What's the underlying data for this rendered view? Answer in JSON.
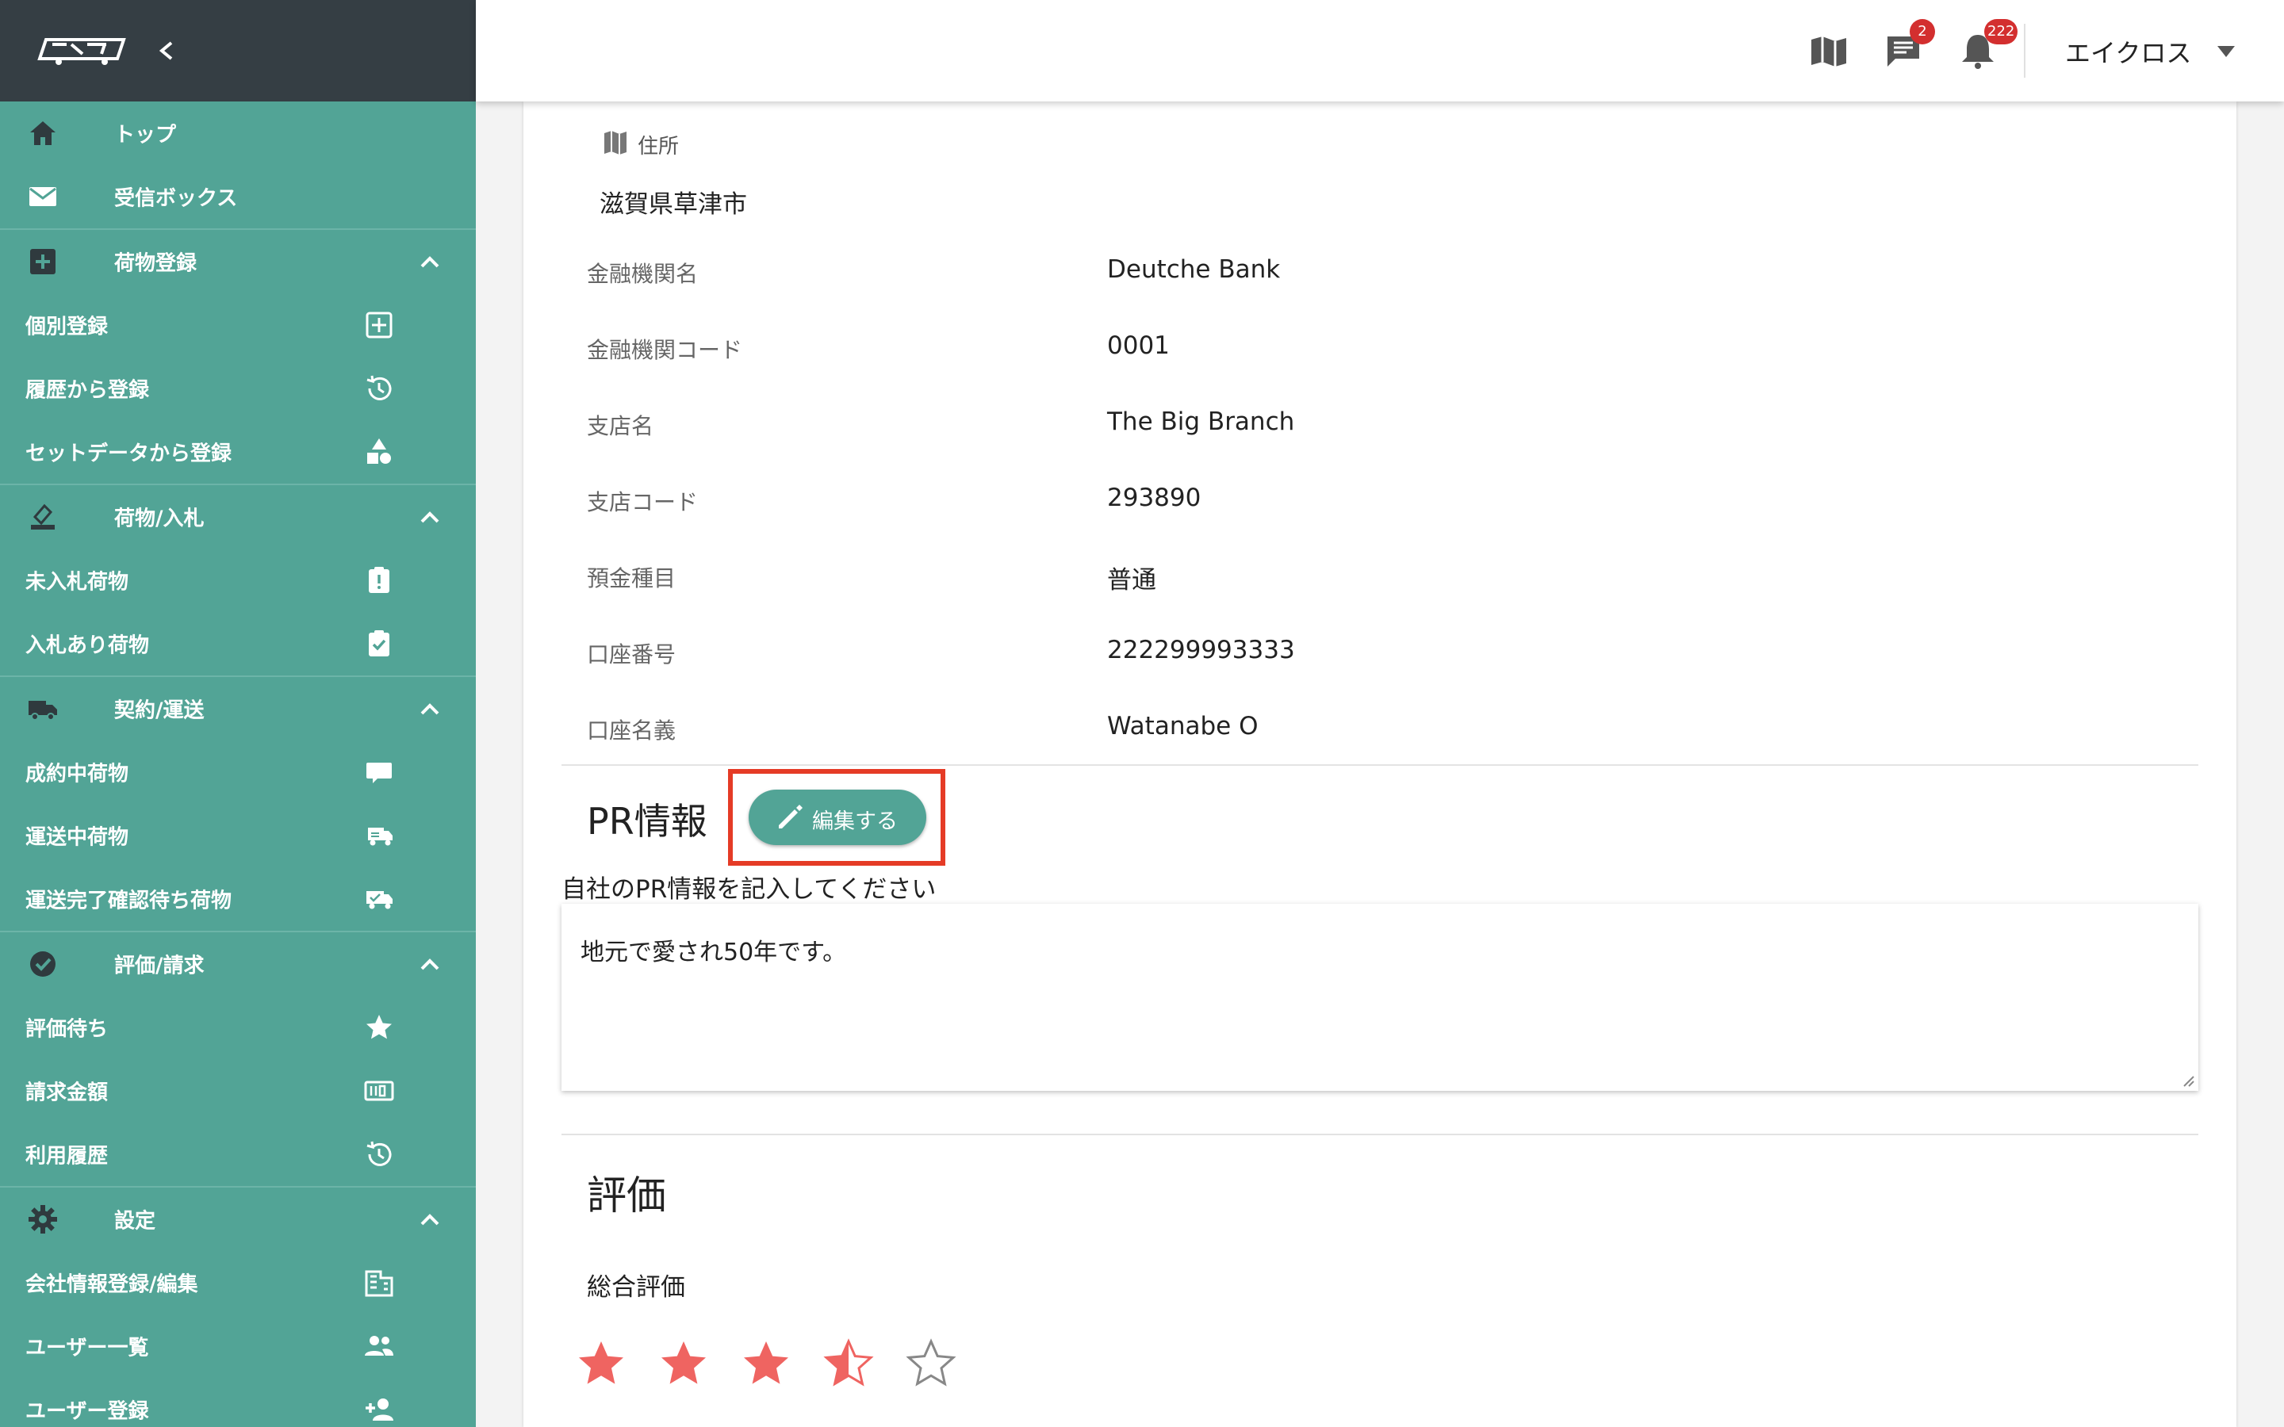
{
  "sidebar": {
    "items": [
      {
        "label": "トップ",
        "type": "top",
        "icon": "home-icon"
      },
      {
        "label": "受信ボックス",
        "type": "top",
        "icon": "mail-icon"
      },
      {
        "label": "荷物登録",
        "type": "section",
        "icon": "add-box-icon"
      },
      {
        "label": "個別登録",
        "type": "sub",
        "icon": "add-square-icon"
      },
      {
        "label": "履歴から登録",
        "type": "sub",
        "icon": "history-icon"
      },
      {
        "label": "セットデータから登録",
        "type": "sub",
        "icon": "shapes-icon"
      },
      {
        "label": "荷物/入札",
        "type": "section",
        "icon": "bid-icon"
      },
      {
        "label": "未入札荷物",
        "type": "sub",
        "icon": "clipboard-alert-icon"
      },
      {
        "label": "入札あり荷物",
        "type": "sub",
        "icon": "clipboard-check-icon"
      },
      {
        "label": "契約/運送",
        "type": "section",
        "icon": "truck-icon"
      },
      {
        "label": "成約中荷物",
        "type": "sub",
        "icon": "truck-small-icon"
      },
      {
        "label": "運送中荷物",
        "type": "sub",
        "icon": "truck-fast-icon"
      },
      {
        "label": "運送完了確認待ち荷物",
        "type": "sub",
        "icon": "truck-check-icon"
      },
      {
        "label": "評価/請求",
        "type": "section",
        "icon": "check-circle-icon"
      },
      {
        "label": "評価待ち",
        "type": "sub",
        "icon": "star-icon"
      },
      {
        "label": "請求金額",
        "type": "sub",
        "icon": "counter-icon"
      },
      {
        "label": "利用履歴",
        "type": "sub",
        "icon": "history-icon"
      },
      {
        "label": "設定",
        "type": "section",
        "icon": "gear-icon"
      },
      {
        "label": "会社情報登録/編集",
        "type": "sub",
        "icon": "building-icon"
      },
      {
        "label": "ユーザー一覧",
        "type": "sub",
        "icon": "users-icon"
      },
      {
        "label": "ユーザー登録",
        "type": "sub",
        "icon": "add-user-icon"
      }
    ]
  },
  "header": {
    "message_badge": "2",
    "notification_badge": "222",
    "user_name": "エイクロス"
  },
  "address": {
    "label": "住所",
    "value": "滋賀県草津市"
  },
  "bank": [
    {
      "label": "金融機関名",
      "value": "Deutche Bank"
    },
    {
      "label": "金融機関コード",
      "value": "0001"
    },
    {
      "label": "支店名",
      "value": "The Big Branch"
    },
    {
      "label": "支店コード",
      "value": "293890"
    },
    {
      "label": "預金種目",
      "value": "普通"
    },
    {
      "label": "口座番号",
      "value": "222299993333"
    },
    {
      "label": "口座名義",
      "value": "Watanabe O"
    }
  ],
  "pr": {
    "title": "PR情報",
    "edit_label": "編集する",
    "hint": "自社のPR情報を記入してください",
    "text": "地元で愛され50年です。"
  },
  "evaluation": {
    "title": "評価",
    "overall_label": "総合評価",
    "rating": 3.5,
    "max": 5,
    "star_color": "#ef6461"
  },
  "colors": {
    "sidebar": "#52a496",
    "sidebar_header": "#353e44",
    "highlight": "#e53b26",
    "badge": "#d32f2f"
  }
}
